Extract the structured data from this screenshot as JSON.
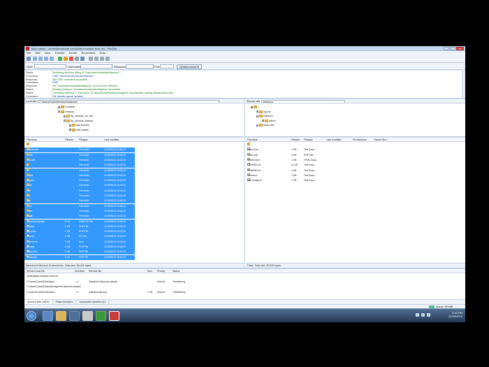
{
  "window": {
    "title": "Mylo nation - admin@example.com@sftp.example-host.net - FileZilla",
    "min_label": "–",
    "max_label": "□",
    "close_label": "x"
  },
  "menu": [
    "File",
    "Edit",
    "View",
    "Transfer",
    "Server",
    "Bookmarks",
    "Help"
  ],
  "quickconnect": {
    "host_label": "Host:",
    "user_label": "Username:",
    "pass_label": "Password:",
    "port_label": "Port:",
    "host_value": "",
    "user_value": "",
    "pass_value": "",
    "port_value": "",
    "button_label": "Quickconnect ▾"
  },
  "message_log": [
    {
      "kind": "Status:",
      "text": "Retrieving directory listing of \"/var/www/vhosts/site/httpdocs\"...",
      "style": "status"
    },
    {
      "kind": "Command:",
      "text": "CWD \"/var/www/vhosts/site/httpdocs\"",
      "style": "cmd"
    },
    {
      "kind": "Response:",
      "text": "250 CWD command successful",
      "style": "resp"
    },
    {
      "kind": "Command:",
      "text": "PWD",
      "style": "cmd"
    },
    {
      "kind": "Response:",
      "text": "257 \"/var/www/vhosts/site/httpdocs\" is the current directory",
      "style": "resp"
    },
    {
      "kind": "Status:",
      "text": "Directory listing of \"/var/www/vhosts/site/httpdocs\" successful",
      "style": "status"
    },
    {
      "kind": "Status:",
      "text": "Connection attempt 1 - Resolved \"C:\\Users\\Guest\\Desktop\\magento\" successfully; adding upload queue files",
      "style": "status"
    },
    {
      "kind": "Command:",
      "text": "File transfer queue updated",
      "style": "cmd"
    }
  ],
  "local": {
    "path_label": "Local site:",
    "path_value": "C:\\Users\\Guest\\Desktop\\magento\\",
    "tree": [
      {
        "label": "Contacts",
        "depth": 0
      },
      {
        "label": "Desktop",
        "depth": 0
      },
      {
        "label": "ftp_uploads_for_site",
        "depth": 1
      },
      {
        "label": "ftp_uploads_backup",
        "depth": 1
      },
      {
        "label": "app-themes",
        "depth": 2
      },
      {
        "label": "skin-assets",
        "depth": 2
      }
    ],
    "columns": {
      "name": "Filename",
      "size": "Filesize",
      "type": "Filetype",
      "modified": "Last modified"
    },
    "files": [
      {
        "name": "..",
        "size": "",
        "type": "",
        "modified": "",
        "icon": "fold",
        "selected": false
      },
      {
        "name": "downloader",
        "size": "",
        "type": "File folder",
        "modified": "21/09/2012 15:43:22",
        "icon": "fold",
        "selected": true
      },
      {
        "name": "errors",
        "size": "",
        "type": "File folder",
        "modified": "21/09/2012 15:43:22",
        "icon": "fold",
        "selected": true
      },
      {
        "name": "includes",
        "size": "",
        "type": "File folder",
        "modified": "21/09/2012 15:43:22",
        "icon": "fold",
        "selected": true
      },
      {
        "name": "js",
        "size": "",
        "type": "File folder",
        "modified": "21/09/2012 15:43:22",
        "icon": "fold",
        "selected": true
      },
      {
        "name": "lib",
        "size": "",
        "type": "File folder",
        "modified": "21/09/2012 15:43:22",
        "icon": "fold",
        "selected": true
      },
      {
        "name": "media",
        "size": "",
        "type": "File folder",
        "modified": "21/09/2012 15:43:22",
        "icon": "fold",
        "selected": true
      },
      {
        "name": "pkginfo",
        "size": "",
        "type": "File folder",
        "modified": "21/09/2012 15:43:22",
        "icon": "fold",
        "selected": true
      },
      {
        "name": "shell",
        "size": "",
        "type": "File folder",
        "modified": "21/09/2012 15:43:22",
        "icon": "fold",
        "selected": true
      },
      {
        "name": "skin",
        "size": "",
        "type": "File folder",
        "modified": "21/09/2012 15:43:22",
        "icon": "fold",
        "selected": true
      },
      {
        "name": "var",
        "size": "",
        "type": "File folder",
        "modified": "21/09/2012 15:43:22",
        "icon": "fold",
        "selected": true
      },
      {
        "name": "app",
        "size": "",
        "type": "File folder",
        "modified": "21/09/2012 15:43:22",
        "icon": "fold",
        "selected": true
      },
      {
        "name": "cron",
        "size": "",
        "type": "File folder",
        "modified": "21/09/2012 15:43:22",
        "icon": "fold",
        "selected": true
      },
      {
        "name": "index",
        "size": "",
        "type": "File folder",
        "modified": "21/09/2012 15:43:22",
        "icon": "fold",
        "selected": true
      },
      {
        "name": "mage",
        "size": "",
        "type": "File folder",
        "modified": "21/09/2012 15:43:22",
        "icon": "fold",
        "selected": true
      },
      {
        "name": ".htaccess.sample",
        "size": "5 KB",
        "type": "SAMPLE File",
        "modified": "21/09/2012 15:43:22",
        "icon": "file",
        "selected": true
      },
      {
        "name": "api.php",
        "size": "2 KB",
        "type": "PHP File",
        "modified": "21/09/2012 15:43:22",
        "icon": "file",
        "selected": true
      },
      {
        "name": "cron.php",
        "size": "2 KB",
        "type": "PHP File",
        "modified": "21/09/2012 15:43:22",
        "icon": "file",
        "selected": true
      },
      {
        "name": "cron.sh",
        "size": "2 KB",
        "type": "SH File",
        "modified": "21/09/2012 15:43:22",
        "icon": "file",
        "selected": true
      },
      {
        "name": "favicon.ico",
        "size": "2 KB",
        "type": "Icon",
        "modified": "21/09/2012 15:43:22",
        "icon": "file",
        "selected": true
      },
      {
        "name": "get.php",
        "size": "3 KB",
        "type": "PHP File",
        "modified": "21/09/2012 15:43:22",
        "icon": "file",
        "selected": true
      },
      {
        "name": "index.php",
        "size": "3 KB",
        "type": "PHP File",
        "modified": "21/09/2012 15:43:22",
        "icon": "file",
        "selected": true
      },
      {
        "name": "install.php",
        "size": "2 KB",
        "type": "PHP File",
        "modified": "21/09/2012 15:43:22",
        "icon": "file",
        "selected": true
      }
    ],
    "status": "Selected 8 files and 15 directories. Total size: 88,941 bytes"
  },
  "remote": {
    "path_label": "Remote site:",
    "path_value": "/httpdocs",
    "tree": [
      {
        "label": "/",
        "depth": 0
      },
      {
        "label": "cgi-bin",
        "depth": 1
      },
      {
        "label": "httpdocs",
        "depth": 1
      },
      {
        "label": "admin",
        "depth": 2
      },
      {
        "label": "plesk-stat",
        "depth": 1
      }
    ],
    "columns": {
      "name": "Filename",
      "size": "Filesize",
      "type": "Filetype",
      "modified": "Last modified",
      "perms": "Permissions",
      "owner": "Owner/Gro..."
    },
    "files": [
      {
        "name": "..",
        "size": "",
        "type": "",
        "icon": "fold"
      },
      {
        "name": "favicon.ico",
        "size": "1 KB",
        "type": "Text Docu..."
      },
      {
        "name": "index.php",
        "size": "3 KB",
        "type": "PHP File"
      },
      {
        "name": "license.html",
        "size": "1 KB",
        "type": "HTML Docu..."
      },
      {
        "name": "LICENSE.txt",
        "size": "11 KB",
        "type": "Text Docu..."
      },
      {
        "name": "README.txt",
        "size": "4 KB",
        "type": "Text Docu..."
      },
      {
        "name": "robots.txt",
        "size": "1 KB",
        "type": "Text Docu..."
      },
      {
        "name": "web.config.txt",
        "size": "1 KB",
        "type": "Text Docu..."
      }
    ],
    "status": "7 files. Total size: 20,949 bytes"
  },
  "queue": {
    "columns": {
      "server": "Server/Local file",
      "direction": "Direction",
      "remote": "Remote file",
      "size": "Size",
      "priority": "Priority",
      "status": "Status"
    },
    "rows": [
      {
        "server": "admin@sftp.example-host.net",
        "direction": "",
        "remote": "",
        "size": "",
        "priority": "",
        "status": ""
      },
      {
        "server": "C:\\Users\\Guest\\Desktop\\m...",
        "direction": "-->>",
        "remote": "/httpdocs/.htaccess.sample",
        "size": "",
        "priority": "Normal",
        "status": "Transferring"
      },
      {
        "server": "   C:\\Users\\Guest\\Desktop\\magento\\.htaccess.sample",
        "direction": "",
        "remote": "",
        "size": "",
        "priority": "",
        "status": ""
      },
      {
        "server": "C:\\Users\\Guest\\Desktop\\m...",
        "direction": "-->>",
        "remote": "/httpdocs/api.php",
        "size": "1 KB",
        "priority": "Normal",
        "status": "Transferring"
      }
    ],
    "tabs": [
      "Queued files (1804)",
      "Failed transfers",
      "Successful transfers (1)"
    ],
    "status": "Queue: 80 MiB"
  },
  "taskbar": {
    "time": "2:33 PM",
    "date": "21/09/2012"
  }
}
